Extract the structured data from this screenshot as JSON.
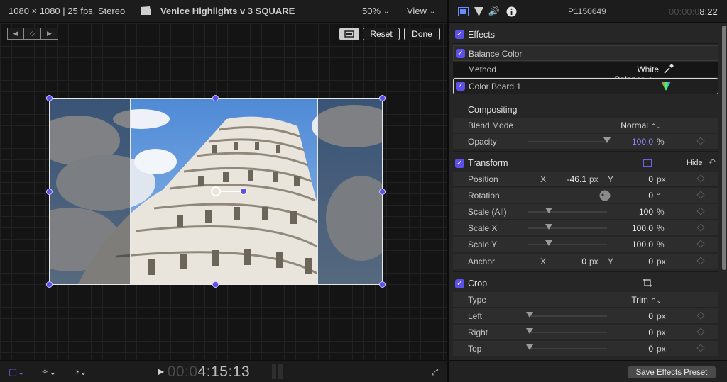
{
  "viewer": {
    "format": "1080 × 1080 | 25 fps, Stereo",
    "project_name": "Venice Highlights v 3 SQUARE",
    "zoom": "50%",
    "view_menu": "View",
    "buttons": {
      "reset": "Reset",
      "done": "Done"
    },
    "timecode_dim": "00:0",
    "timecode": "4:15:13"
  },
  "inspector": {
    "clip_name": "P1150649",
    "duration_dim": "00:00:0",
    "duration": "8:22",
    "effects": {
      "title": "Effects",
      "balance_color": {
        "label": "Balance Color",
        "method_label": "Method",
        "method_value": "White Balance"
      },
      "color_board": {
        "label": "Color Board 1"
      }
    },
    "compositing": {
      "title": "Compositing",
      "blend_mode_label": "Blend Mode",
      "blend_mode_value": "Normal",
      "opacity_label": "Opacity",
      "opacity_value": "100.0",
      "opacity_unit": "%"
    },
    "transform": {
      "title": "Transform",
      "hide": "Hide",
      "position_label": "Position",
      "position_x_axis": "X",
      "position_x": "-46.1",
      "position_x_unit": "px",
      "position_y_axis": "Y",
      "position_y": "0",
      "position_y_unit": "px",
      "rotation_label": "Rotation",
      "rotation_value": "0",
      "rotation_unit": "°",
      "scale_all_label": "Scale (All)",
      "scale_all_value": "100",
      "scale_all_unit": "%",
      "scale_x_label": "Scale X",
      "scale_x_value": "100.0",
      "scale_x_unit": "%",
      "scale_y_label": "Scale Y",
      "scale_y_value": "100.0",
      "scale_y_unit": "%",
      "anchor_label": "Anchor",
      "anchor_x_axis": "X",
      "anchor_x": "0",
      "anchor_x_unit": "px",
      "anchor_y_axis": "Y",
      "anchor_y": "0",
      "anchor_y_unit": "px"
    },
    "crop": {
      "title": "Crop",
      "type_label": "Type",
      "type_value": "Trim",
      "left_label": "Left",
      "left_value": "0",
      "left_unit": "px",
      "right_label": "Right",
      "right_value": "0",
      "right_unit": "px",
      "top_label": "Top",
      "top_value": "0",
      "top_unit": "px"
    },
    "save_preset": "Save Effects Preset"
  },
  "colors": {
    "accent": "#5b51e8",
    "opacity_value": "#8e86ff"
  }
}
